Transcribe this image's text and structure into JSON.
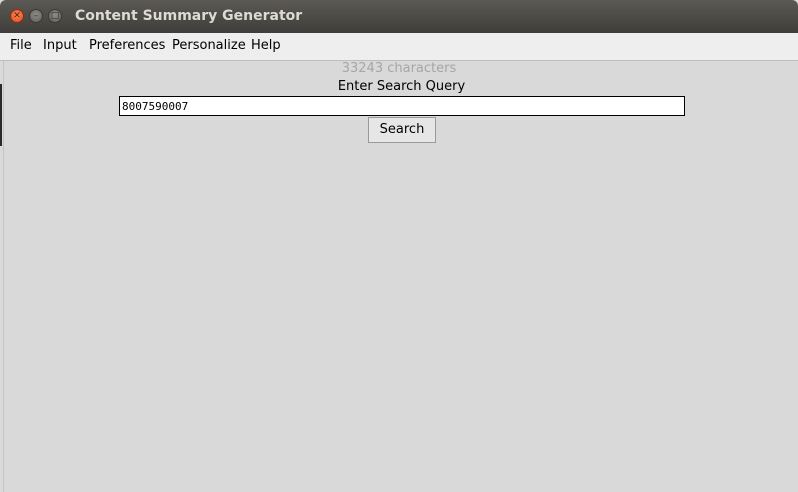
{
  "window": {
    "title": "Content Summary Generator"
  },
  "menubar": {
    "items": [
      {
        "label": "File"
      },
      {
        "label": "Input"
      },
      {
        "label": "Preferences"
      },
      {
        "label": "Personalize"
      },
      {
        "label": "Help"
      }
    ]
  },
  "main": {
    "char_count": "33243 characters",
    "prompt": "Enter Search Query",
    "search_value": "8007590007",
    "search_button_label": "Search"
  },
  "colors": {
    "titlebar": "#3f3e3a",
    "close_button": "#df4a16",
    "background": "#d9d9d9",
    "menubar": "#eeeeee",
    "char_count_text": "#a6a6a6"
  }
}
